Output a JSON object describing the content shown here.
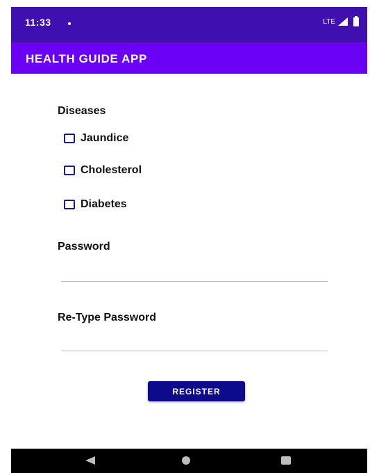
{
  "status_bar": {
    "time": "11:33",
    "network": "LTE",
    "icons": [
      "notification-dot-icon",
      "signal-icon",
      "battery-icon"
    ],
    "background_color": "#3f0fb0"
  },
  "app_bar": {
    "title": "HEALTH GUIDE APP",
    "background_color": "#6a00f4"
  },
  "form": {
    "diseases_heading": "Diseases",
    "diseases": [
      {
        "label": "Jaundice",
        "checked": false
      },
      {
        "label": "Cholesterol",
        "checked": false
      },
      {
        "label": "Diabetes",
        "checked": false
      }
    ],
    "password_label": "Password",
    "password_value": "",
    "retype_password_label": "Re-Type Password",
    "retype_password_value": "",
    "register_label": "REGISTER",
    "button_color": "#0d0b8c"
  },
  "nav_bar": {
    "icons": [
      "back-icon",
      "home-icon",
      "recents-icon"
    ]
  }
}
